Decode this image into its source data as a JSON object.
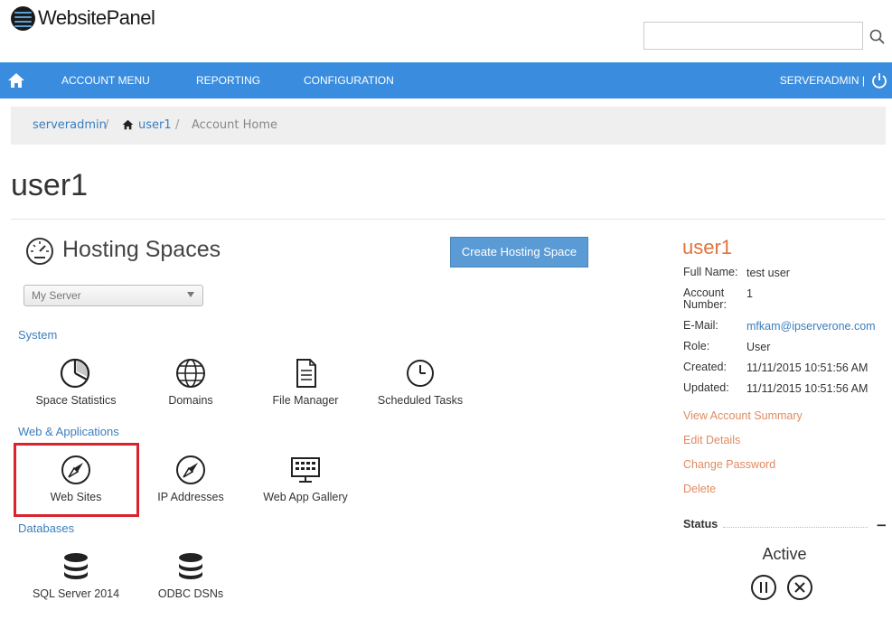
{
  "header": {
    "logo_text": "WebsitePanel",
    "search": {
      "placeholder": "",
      "value": ""
    }
  },
  "nav": {
    "items": [
      {
        "label": "ACCOUNT MENU"
      },
      {
        "label": "REPORTING"
      },
      {
        "label": "CONFIGURATION"
      }
    ],
    "user_label": "SERVERADMIN |",
    "color": "#3a8dde"
  },
  "breadcrumb": {
    "items": [
      {
        "label": "serveradmin"
      },
      {
        "label": "user1"
      },
      {
        "label": "Account Home"
      }
    ],
    "separator": "/"
  },
  "page": {
    "title": "user1"
  },
  "hosting_spaces": {
    "title": "Hosting Spaces",
    "create_button": "Create Hosting Space",
    "server_select": "My Server",
    "sections": [
      {
        "label": "System",
        "tiles": [
          {
            "label": "Space Statistics",
            "icon": "pie-chart-icon"
          },
          {
            "label": "Domains",
            "icon": "globe-icon"
          },
          {
            "label": "File Manager",
            "icon": "document-icon"
          },
          {
            "label": "Scheduled Tasks",
            "icon": "clock-icon"
          }
        ]
      },
      {
        "label": "Web & Applications",
        "tiles": [
          {
            "label": "Web Sites",
            "icon": "compass-icon"
          },
          {
            "label": "IP Addresses",
            "icon": "compass-icon"
          },
          {
            "label": "Web App Gallery",
            "icon": "keyboard-icon"
          }
        ]
      },
      {
        "label": "Databases",
        "tiles": [
          {
            "label": "SQL Server 2014",
            "icon": "database-icon"
          },
          {
            "label": "ODBC DSNs",
            "icon": "database-icon"
          }
        ]
      }
    ]
  },
  "account": {
    "title": "user1",
    "fields": [
      {
        "label": "Full Name:",
        "value": "test user"
      },
      {
        "label": "Account Number:",
        "value": "1"
      },
      {
        "label": "E-Mail:",
        "value": "mfkam@ipserverone.com"
      },
      {
        "label": "Role:",
        "value": "User"
      },
      {
        "label": "Created:",
        "value": "11/11/2015 10:51:56 AM"
      },
      {
        "label": "Updated:",
        "value": "11/11/2015 10:51:56 AM"
      }
    ],
    "links": [
      {
        "label": "View Account Summary"
      },
      {
        "label": "Edit Details"
      },
      {
        "label": "Change Password"
      },
      {
        "label": "Delete"
      }
    ],
    "status": {
      "label": "Status",
      "collapse": "−",
      "value": "Active"
    },
    "accent_color": "#e0743a",
    "highlight_color": "#d9232d"
  }
}
